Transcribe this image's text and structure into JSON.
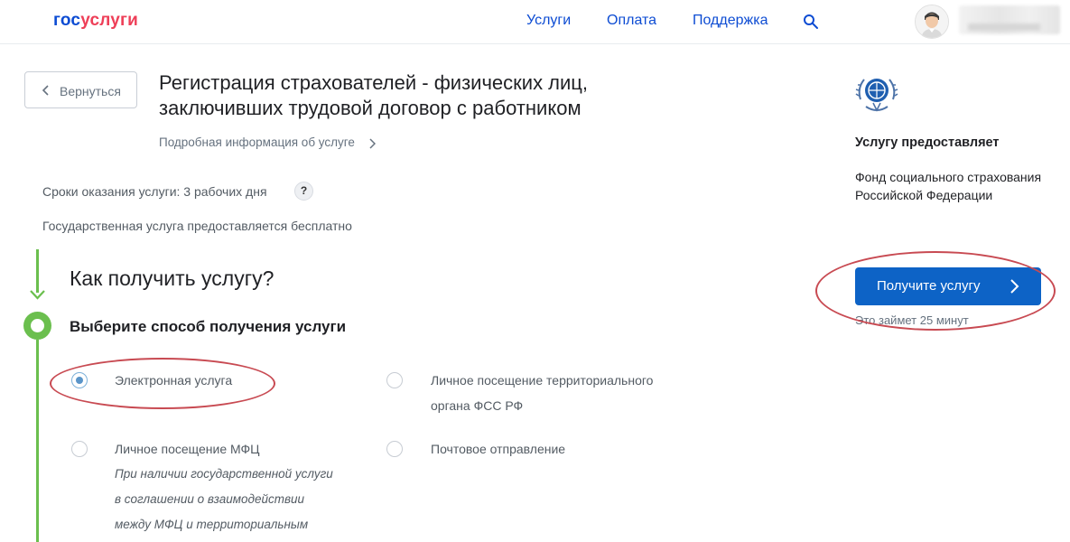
{
  "header": {
    "logo_part1": "гос",
    "logo_part2": "услуги",
    "nav": [
      "Услуги",
      "Оплата",
      "Поддержка"
    ],
    "search_icon": "search-icon",
    "avatar_icon": "user-avatar-icon"
  },
  "back_button": {
    "label": "Вернуться"
  },
  "service": {
    "title_line1": "Регистрация страхователей - физических лиц,",
    "title_line2": "заключивших трудовой договор с работником",
    "info_link": "Подробная информация об услуге",
    "terms": "Сроки оказания услуги: 3 рабочих дня",
    "help": "?",
    "free": "Государственная услуга предоставляется бесплатно"
  },
  "how": {
    "title": "Как получить услугу?",
    "subtitle": "Выберите способ получения услуги",
    "options": [
      {
        "label": "Электронная услуга",
        "checked": true
      },
      {
        "label_line1": "Личное посещение территориального",
        "label_line2": "органа ФСС РФ",
        "checked": false
      },
      {
        "label": "Личное посещение МФЦ",
        "note_lines": [
          "При наличии государственной услуги",
          "в соглашении о взаимодействии",
          "между МФЦ и территориальным"
        ],
        "checked": false
      },
      {
        "label": "Почтовое отправление",
        "checked": false
      }
    ]
  },
  "provider": {
    "heading": "Услугу предоставляет",
    "name_line1": "Фонд социального страхования",
    "name_line2": "Российской Федерации",
    "logo_icon": "fss-emblem-icon"
  },
  "cta": {
    "label": "Получите услугу",
    "time": "Это займет 25 минут"
  },
  "colors": {
    "brand_blue": "#0d4cd3",
    "brand_red": "#ee3f58",
    "progress_green": "#6bbf4e",
    "button_blue": "#0d63c6",
    "annotation_red": "#c84a52"
  }
}
